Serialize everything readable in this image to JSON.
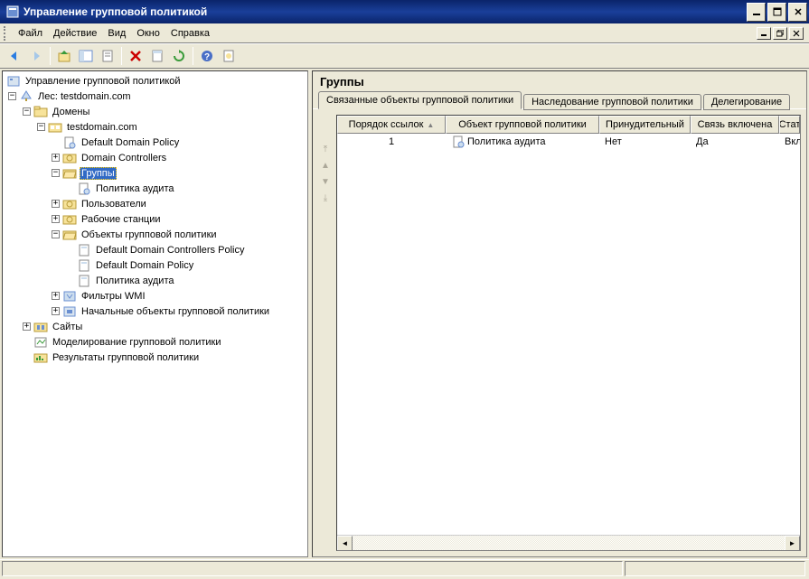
{
  "window": {
    "title": "Управление групповой политикой"
  },
  "menu": {
    "file": "Файл",
    "action": "Действие",
    "view": "Вид",
    "window": "Окно",
    "help": "Справка"
  },
  "tree": {
    "root": "Управление групповой политикой",
    "forest": "Лес: testdomain.com",
    "domains": "Домены",
    "domain": "testdomain.com",
    "default_policy": "Default Domain Policy",
    "domain_controllers": "Domain Controllers",
    "groups": "Группы",
    "audit_policy": "Политика аудита",
    "users": "Пользователи",
    "workstations": "Рабочие станции",
    "gp_objects": "Объекты групповой политики",
    "ddcp": "Default Domain Controllers Policy",
    "ddp": "Default Domain Policy",
    "audit_policy2": "Политика аудита",
    "wmi_filters": "Фильтры WMI",
    "starter_gpo": "Начальные объекты групповой политики",
    "sites": "Сайты",
    "modeling": "Моделирование групповой политики",
    "results": "Результаты групповой политики"
  },
  "right": {
    "title": "Группы",
    "tabs": {
      "linked": "Связанные объекты групповой политики",
      "inheritance": "Наследование групповой политики",
      "delegation": "Делегирование"
    },
    "columns": {
      "link_order": "Порядок ссылок",
      "gpo": "Объект групповой политики",
      "enforced": "Принудительный",
      "link_enabled": "Связь включена",
      "status": "Стат"
    },
    "row": {
      "order": "1",
      "gpo": "Политика аудита",
      "enforced": "Нет",
      "link_enabled": "Да",
      "status": "Вкл"
    }
  }
}
